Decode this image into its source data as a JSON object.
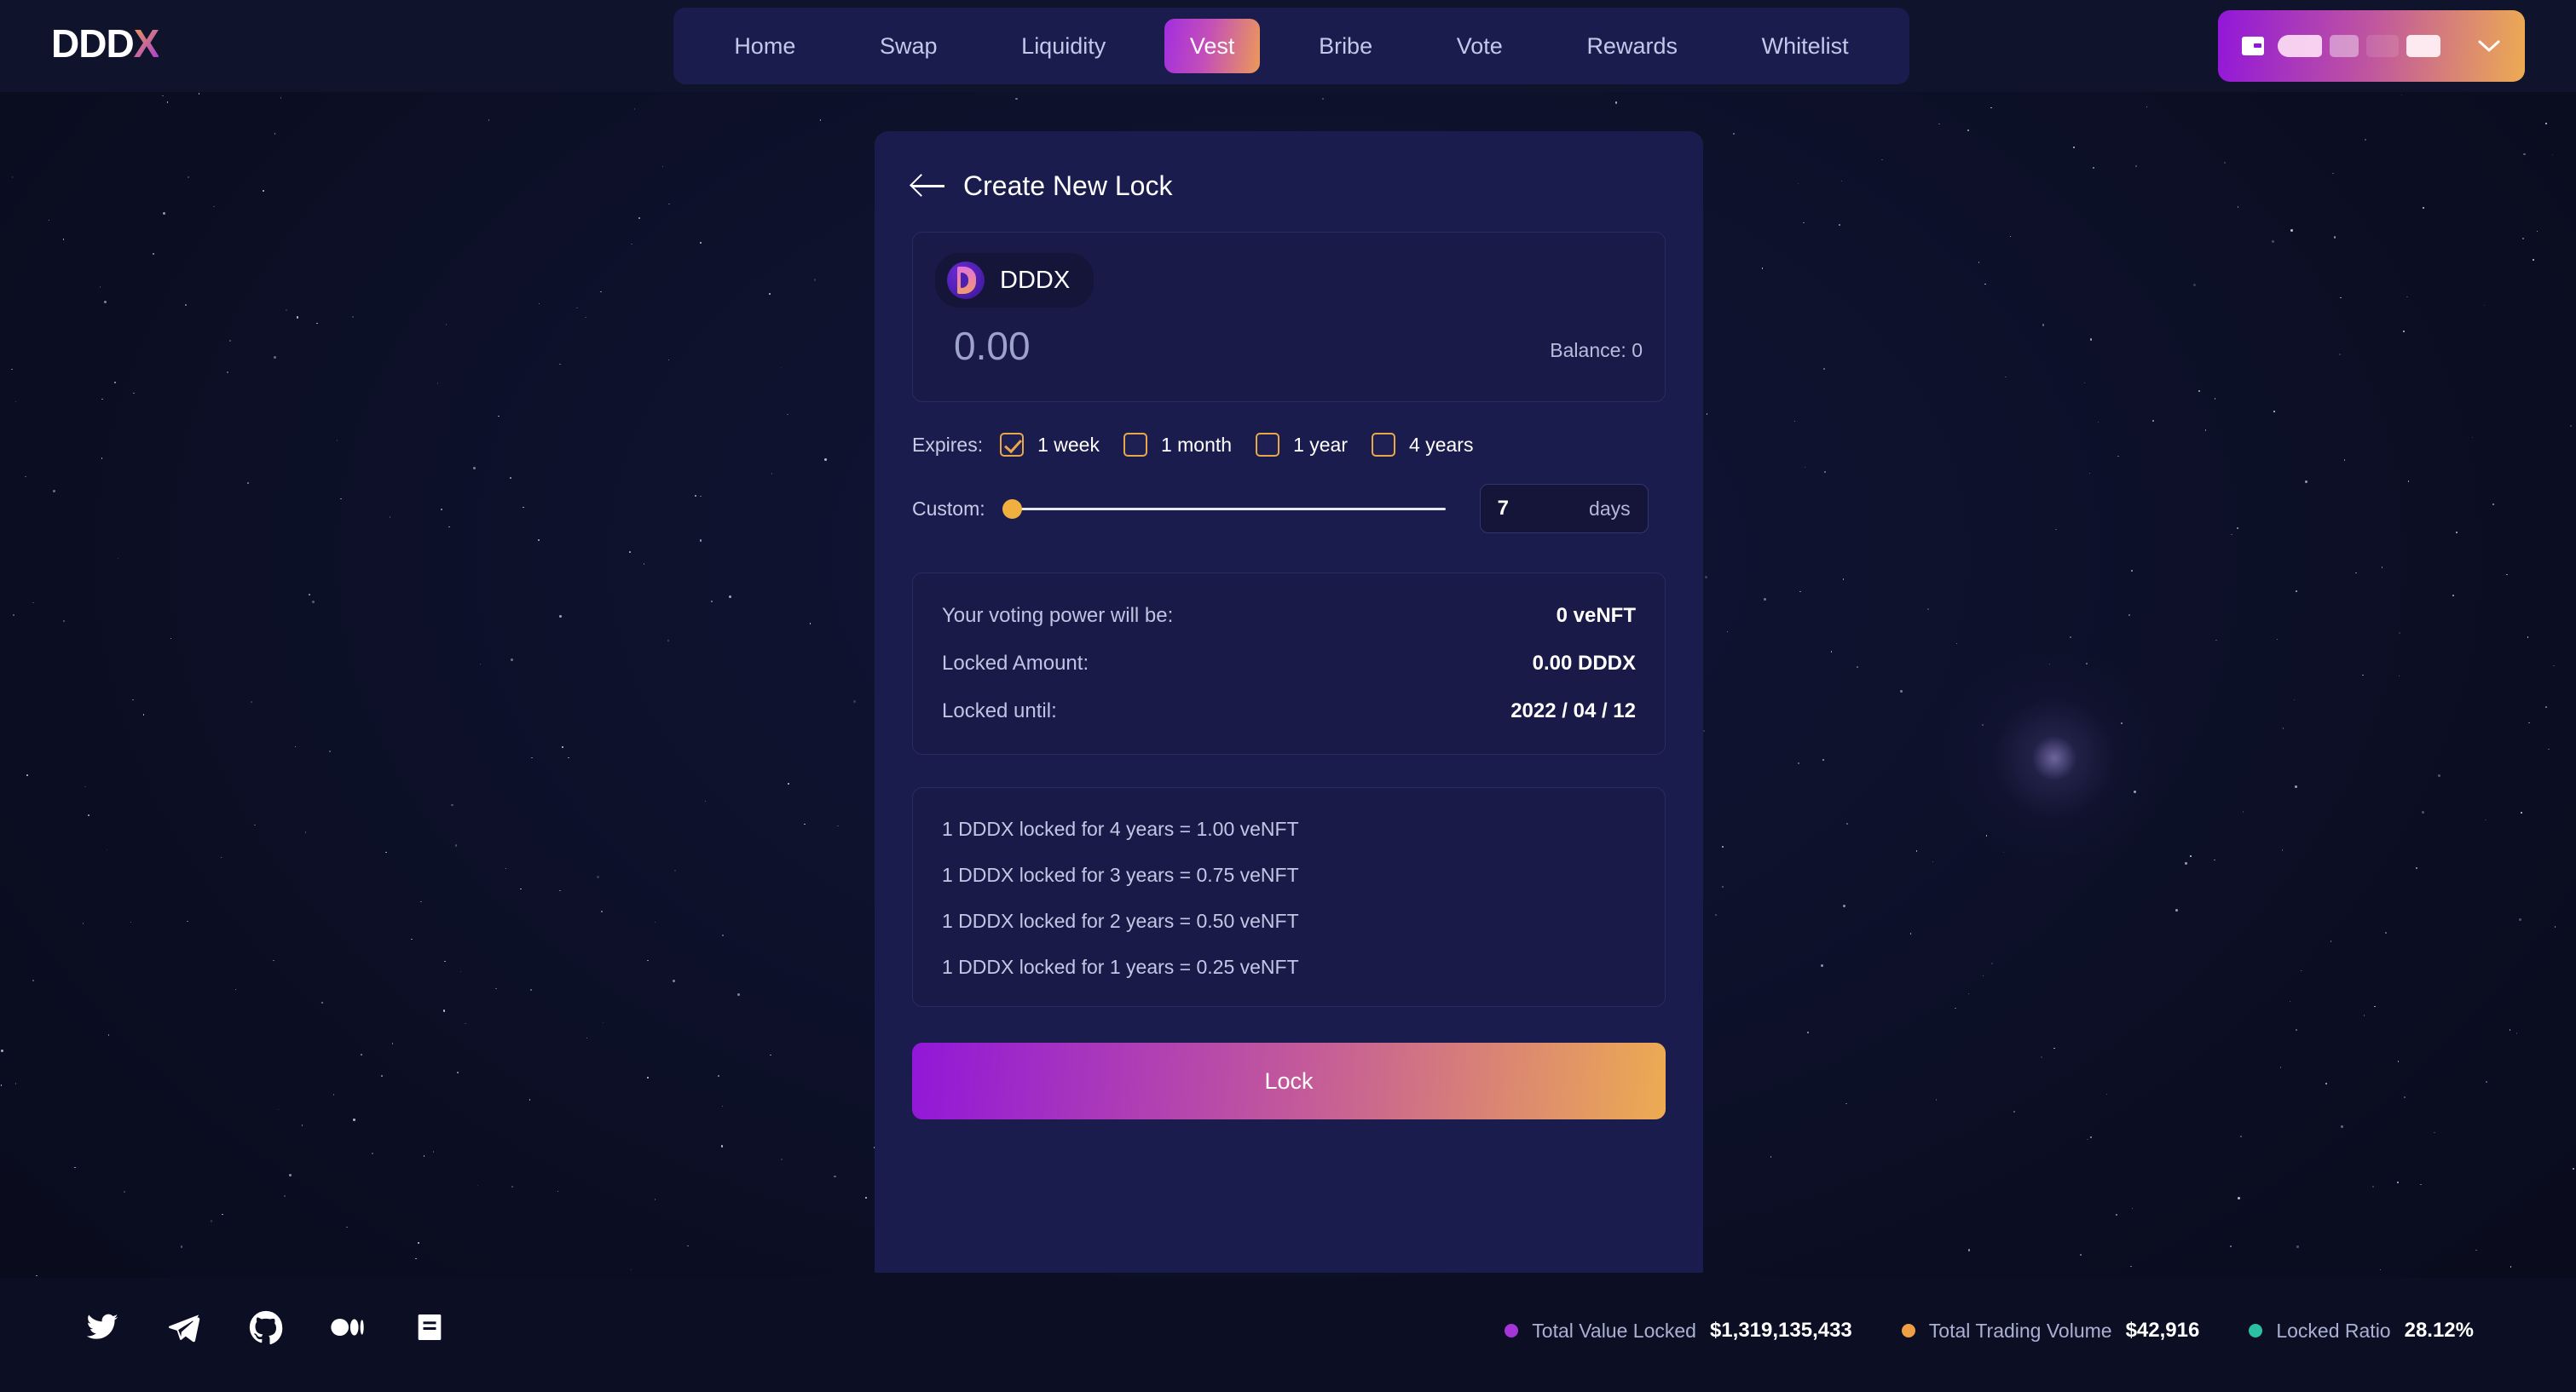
{
  "brand": {
    "logo_main": "DDD",
    "logo_accent": "X"
  },
  "nav": {
    "items": [
      {
        "label": "Home",
        "active": false
      },
      {
        "label": "Swap",
        "active": false
      },
      {
        "label": "Liquidity",
        "active": false
      },
      {
        "label": "Vest",
        "active": true
      },
      {
        "label": "Bribe",
        "active": false
      },
      {
        "label": "Vote",
        "active": false
      },
      {
        "label": "Rewards",
        "active": false
      },
      {
        "label": "Whitelist",
        "active": false
      }
    ]
  },
  "wallet": {
    "address_masked": "",
    "chevron": "⌄"
  },
  "card": {
    "title": "Create New Lock",
    "back_icon": "arrow-left-icon",
    "token": {
      "symbol": "DDDX",
      "logo": "dddx-token-icon"
    },
    "amount": {
      "value": "0.00",
      "placeholder": "0.00"
    },
    "balance_label": "Balance: 0",
    "expires": {
      "label": "Expires:",
      "options": [
        {
          "label": "1 week",
          "checked": true
        },
        {
          "label": "1 month",
          "checked": false
        },
        {
          "label": "1 year",
          "checked": false
        },
        {
          "label": "4 years",
          "checked": false
        }
      ]
    },
    "custom": {
      "label": "Custom:",
      "slider_percent": 0,
      "days_value": "7",
      "days_unit": "days"
    },
    "summary": [
      {
        "key": "Your voting power will be:",
        "value": "0 veNFT"
      },
      {
        "key": "Locked Amount:",
        "value": "0.00 DDDX"
      },
      {
        "key": "Locked until:",
        "value": "2022 / 04 / 12"
      }
    ],
    "rates": [
      "1 DDDX locked for 4 years = 1.00 veNFT",
      "1 DDDX locked for 3 years = 0.75 veNFT",
      "1 DDDX locked for 2 years = 0.50 veNFT",
      "1 DDDX locked for 1 years = 0.25 veNFT"
    ],
    "lock_button": "Lock"
  },
  "footer": {
    "socials": [
      {
        "name": "twitter-icon"
      },
      {
        "name": "telegram-icon"
      },
      {
        "name": "github-icon"
      },
      {
        "name": "medium-icon"
      },
      {
        "name": "docs-icon"
      }
    ],
    "stats": [
      {
        "label": "Total Value Locked",
        "value": "$1,319,135,433",
        "color": "#a435d8"
      },
      {
        "label": "Total Trading Volume",
        "value": "$42,916",
        "color": "#ef9e44"
      },
      {
        "label": "Locked Ratio",
        "value": "28.12%",
        "color": "#2bbfa6"
      }
    ]
  },
  "colors": {
    "accent_purple": "#9217d9",
    "accent_orange": "#edab52",
    "card_bg": "#1b1c4e",
    "page_bg": "#0c0f24"
  }
}
